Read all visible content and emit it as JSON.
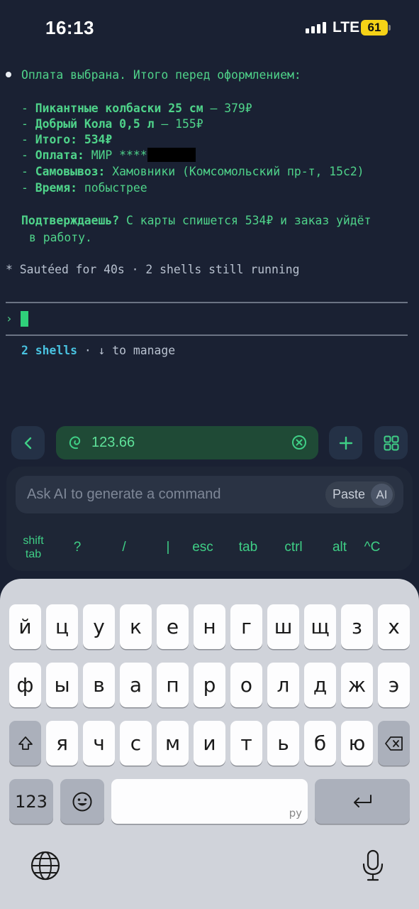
{
  "status_bar": {
    "time": "16:13",
    "network": "LTE",
    "battery": "61"
  },
  "terminal": {
    "line1": "Оплата выбрана. Итого перед оформлением:",
    "items": [
      {
        "prefix": "- ",
        "label": "Пикантные колбаски 25 см",
        "value": " — 379₽"
      },
      {
        "prefix": "- ",
        "label": "Добрый Кола 0,5 л",
        "value": " — 155₽"
      },
      {
        "prefix": "- ",
        "label": "Итого: 534₽",
        "value": ""
      },
      {
        "prefix": "- ",
        "label": "Оплата:",
        "value": " МИР ****"
      },
      {
        "prefix": "- ",
        "label": "Самовывоз:",
        "value": " Хамовники (Комсомольский пр-т, 15с2)"
      },
      {
        "prefix": "- ",
        "label": "Время:",
        "value": " побыстрее"
      }
    ],
    "confirm_label": "Подтверждаешь?",
    "confirm_text_1": " С карты спишется 534₽ и заказ уйдёт",
    "confirm_text_2": "в работу.",
    "status_line": "* Sautéed for 40s · 2 shells still running",
    "prompt_symbol": "›",
    "shells_label": "2 shells",
    "shells_hint": " · ↓ to manage"
  },
  "toolbar": {
    "host": "123.66"
  },
  "ai_panel": {
    "placeholder": "Ask AI to generate a command",
    "paste_label": "Paste",
    "ai_label": "AI",
    "keys": [
      "shift\ntab",
      "?",
      "/",
      "|",
      "esc",
      "tab",
      "ctrl",
      "alt",
      "^C"
    ]
  },
  "keyboard": {
    "row1": [
      "й",
      "ц",
      "у",
      "к",
      "е",
      "н",
      "г",
      "ш",
      "щ",
      "з",
      "х"
    ],
    "row2": [
      "ф",
      "ы",
      "в",
      "а",
      "п",
      "р",
      "о",
      "л",
      "д",
      "ж",
      "э"
    ],
    "row3": [
      "я",
      "ч",
      "с",
      "м",
      "и",
      "т",
      "ь",
      "б",
      "ю"
    ],
    "numbers_label": "123",
    "space_hint": "ру"
  }
}
